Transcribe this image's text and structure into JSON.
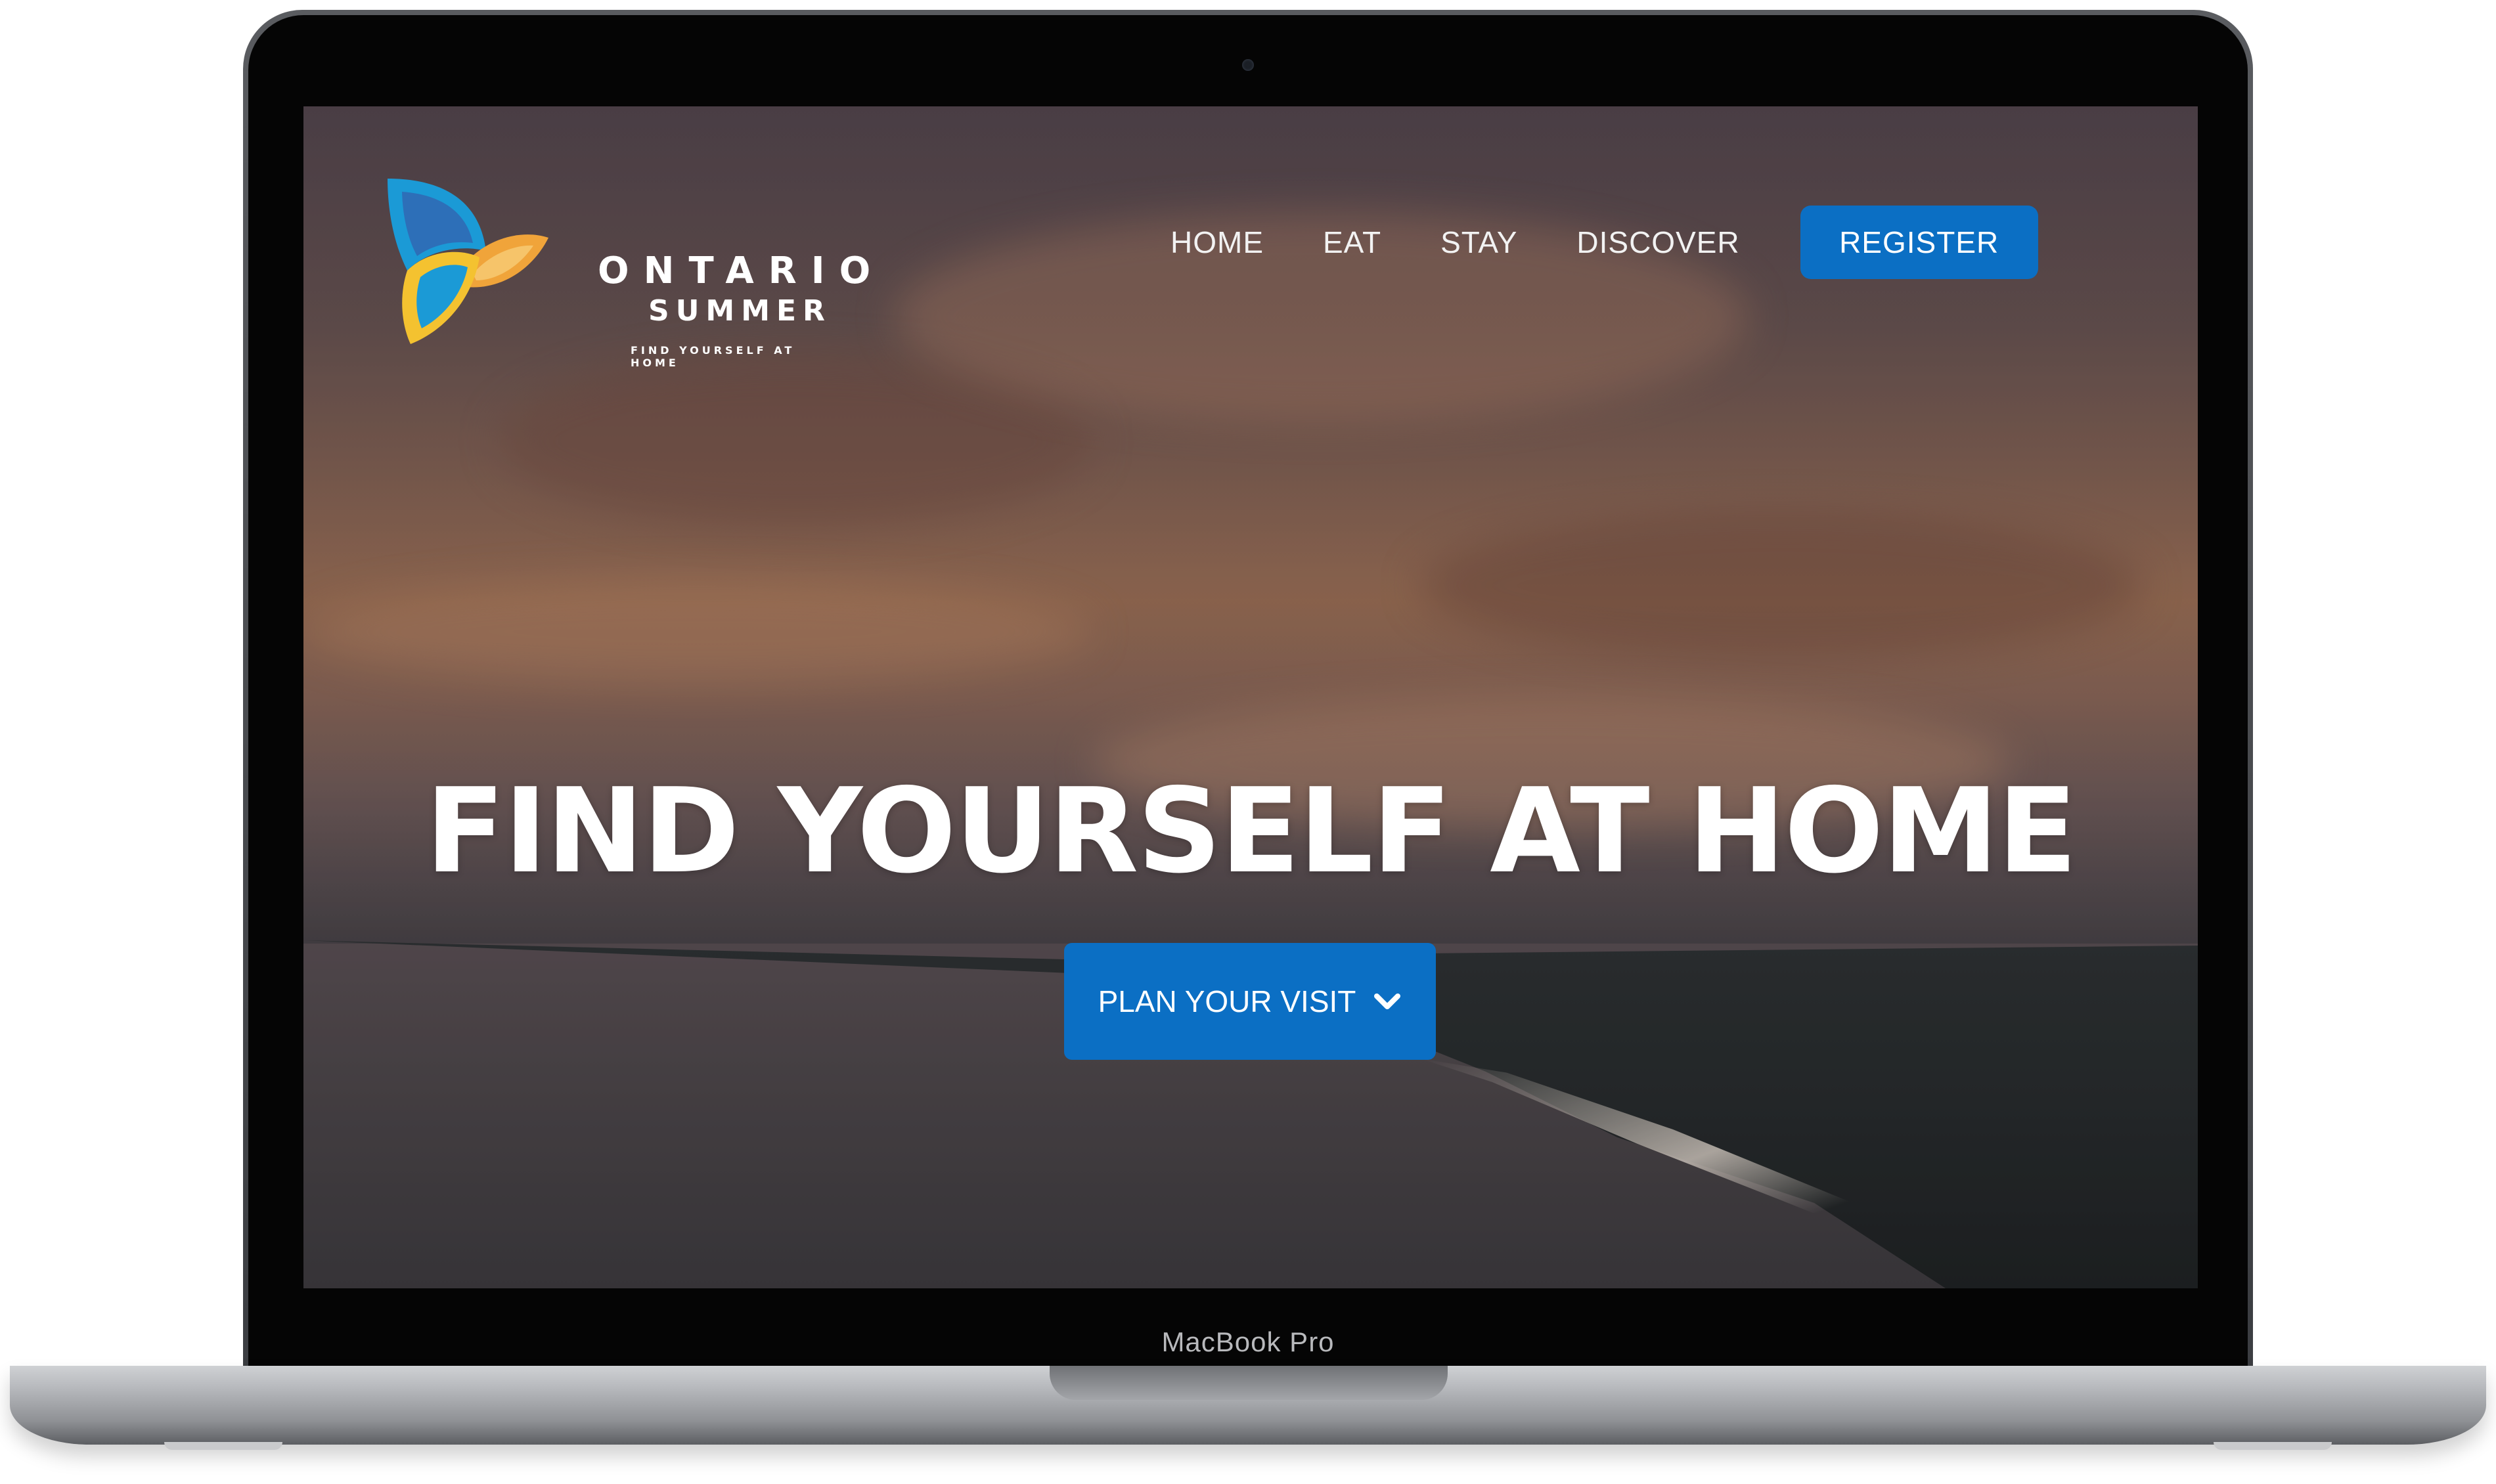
{
  "device": {
    "model_label": "MacBook Pro"
  },
  "site": {
    "logo": {
      "line1": "ONTARIO",
      "line2": "SUMMER",
      "tagline": "FIND YOURSELF AT HOME",
      "colors": {
        "blue": "#1b9ad6",
        "orange": "#f0a43a",
        "yellow": "#f4c230"
      }
    },
    "nav": {
      "items": [
        {
          "label": "HOME"
        },
        {
          "label": "EAT"
        },
        {
          "label": "STAY"
        },
        {
          "label": "DISCOVER"
        }
      ],
      "register_label": "REGISTER"
    },
    "hero": {
      "title": "FIND YOURSELF AT HOME",
      "cta_label": "PLAN YOUR VISIT",
      "cta_icon": "chevron-down-icon"
    },
    "colors": {
      "accent": "#0b6fc4",
      "text": "#ffffff"
    }
  }
}
